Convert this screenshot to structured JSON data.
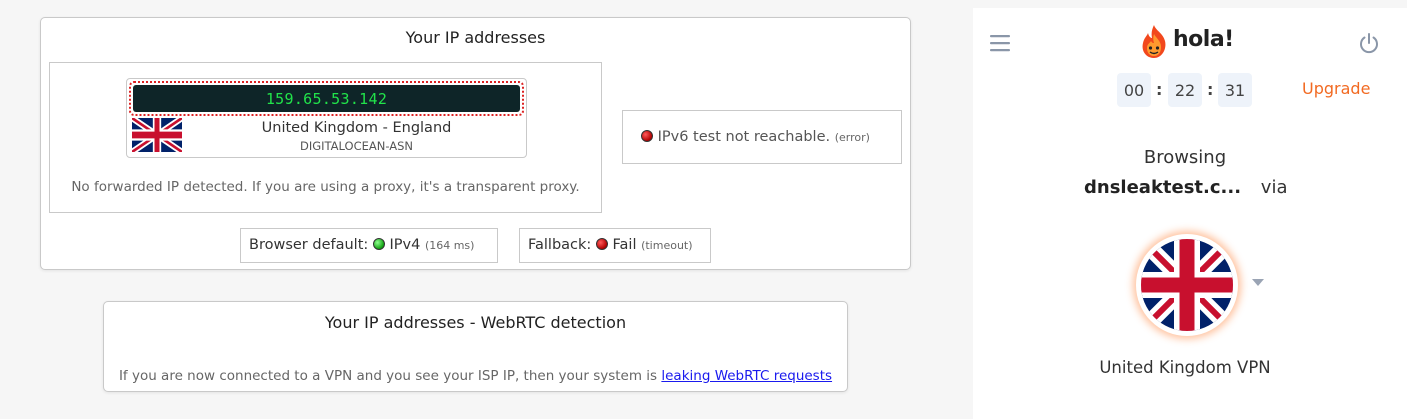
{
  "ip_card": {
    "title": "Your IP addresses",
    "ipv4": {
      "address": "159.65.53.142",
      "location": "United Kingdom - England",
      "asn": "DIGITALOCEAN-ASN",
      "flag_icon": "uk-flag-icon"
    },
    "no_forward_text": "No forwarded IP detected. If you are using a proxy, it's a transparent proxy.",
    "ipv6": {
      "status_text": "IPv6 test not reachable.",
      "status_note": "(error)",
      "status_color": "#cc0000"
    },
    "browser_default": {
      "label": "Browser default:",
      "value": "IPv4",
      "note": "(164 ms)",
      "status_color": "#10a010"
    },
    "fallback": {
      "label": "Fallback:",
      "value": "Fail",
      "note": "(timeout)",
      "status_color": "#cc0000"
    }
  },
  "webrtc_card": {
    "title": "Your IP addresses - WebRTC detection",
    "text": "If you are now connected to a VPN and you see your ISP IP, then your system is",
    "link_text": "leaking WebRTC requests"
  },
  "hola": {
    "logo_text": "hola!",
    "menu_icon": "hamburger-menu-icon",
    "power_icon": "power-icon",
    "timer": {
      "hours": "00",
      "minutes": "22",
      "seconds": "31"
    },
    "upgrade_label": "Upgrade",
    "browsing_label": "Browsing",
    "site": "dnsleaktest.c...",
    "via_label": "via",
    "country_label": "United Kingdom VPN",
    "accent_color": "#f26a22"
  }
}
